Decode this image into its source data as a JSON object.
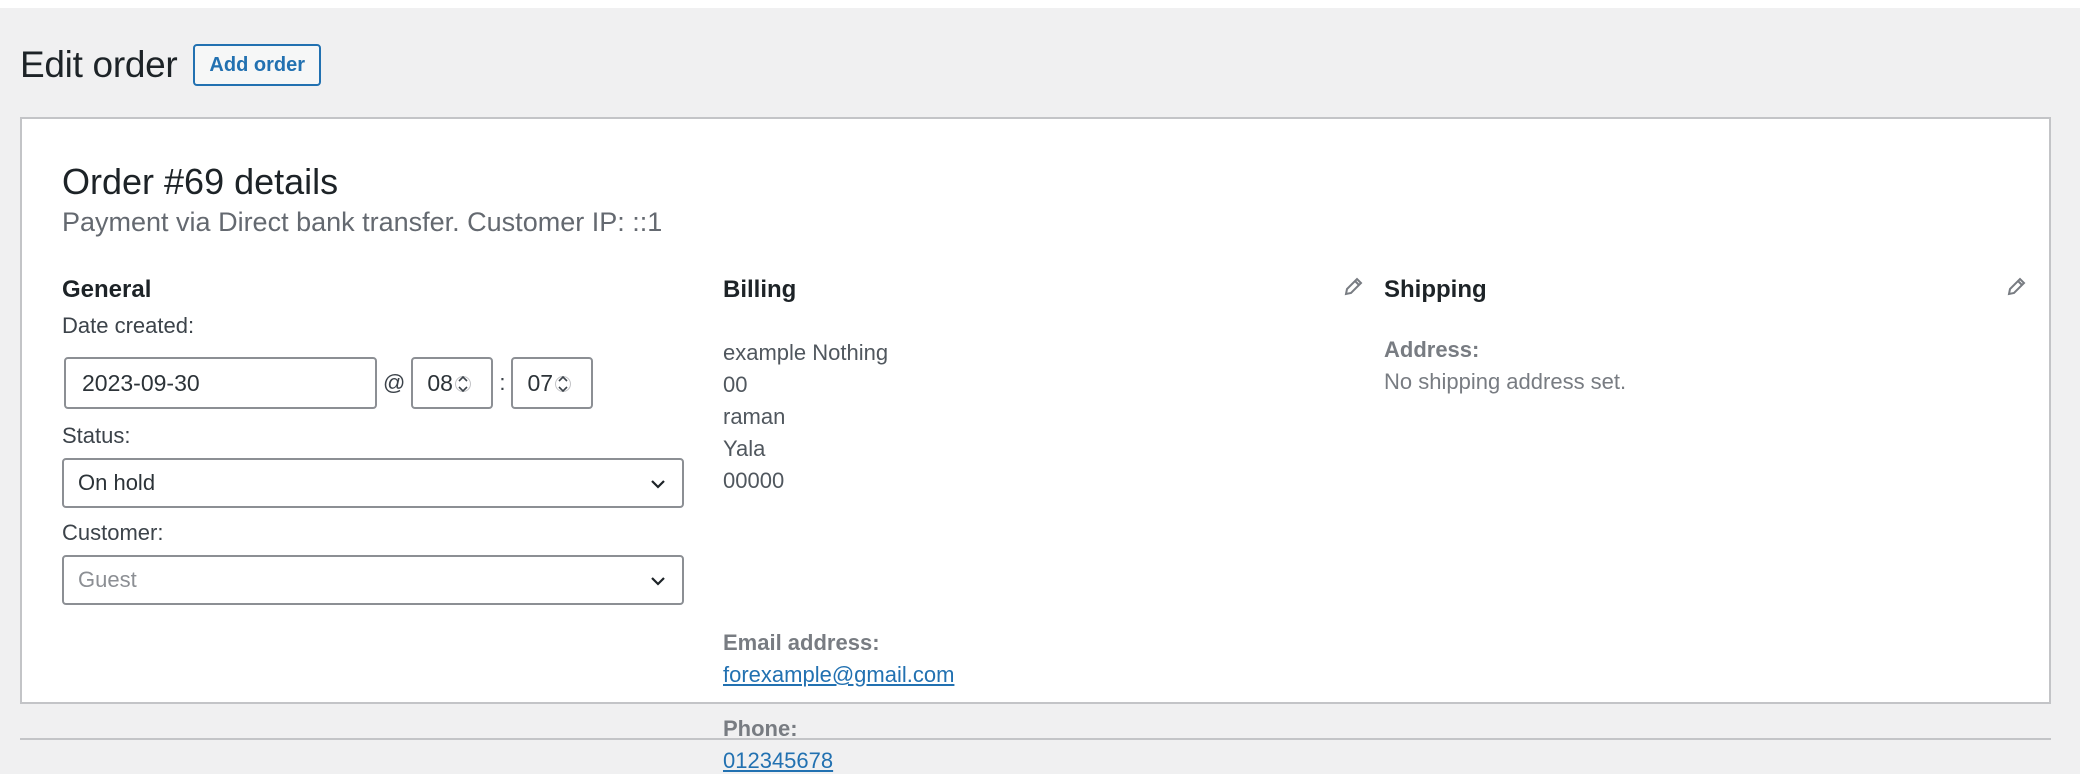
{
  "header": {
    "title": "Edit order",
    "add_button": "Add order"
  },
  "order": {
    "heading": "Order #69 details",
    "meta": "Payment via Direct bank transfer. Customer IP: ::1"
  },
  "general": {
    "title": "General",
    "date_label": "Date created:",
    "date_value": "2023-09-30",
    "at_sep": "@",
    "hour_value": "08",
    "colon_sep": ":",
    "minute_value": "07",
    "status_label": "Status:",
    "status_value": "On hold",
    "customer_label": "Customer:",
    "customer_value": "Guest"
  },
  "billing": {
    "title": "Billing",
    "address_lines": [
      "example Nothing",
      "00",
      "raman",
      "Yala",
      "00000"
    ],
    "email_label": "Email address:",
    "email_value": "forexample@gmail.com",
    "phone_label": "Phone:",
    "phone_value": "012345678"
  },
  "shipping": {
    "title": "Shipping",
    "address_label": "Address:",
    "address_value": "No shipping address set."
  },
  "icons": {
    "edit": "pencil-icon",
    "dropdown": "chevron-down-icon",
    "spinner": "spinner-arrows-icon"
  },
  "colors": {
    "accent": "#2271b1",
    "background": "#f0f0f1",
    "panel": "#ffffff",
    "border": "#c3c4c7"
  }
}
